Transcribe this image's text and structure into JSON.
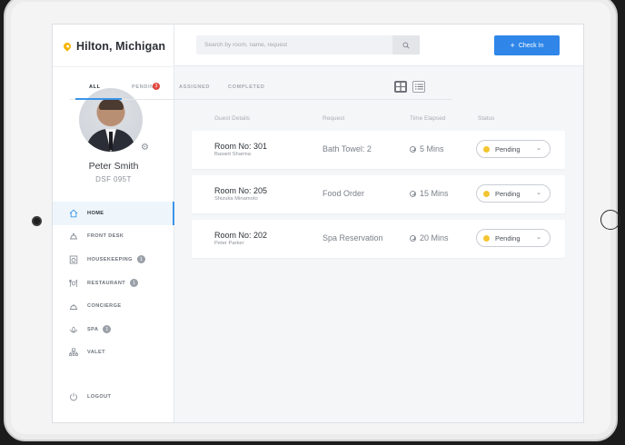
{
  "brand": {
    "title": "Hilton, Michigan",
    "icon": "location-pin-icon",
    "accent": "#f5b400"
  },
  "profile": {
    "name": "Peter Smith",
    "code": "DSF 095T"
  },
  "search": {
    "placeholder": "Search by room, name, request"
  },
  "actions": {
    "check_in_label": "Check In",
    "primary_color": "#2f86e8"
  },
  "nav": [
    {
      "label": "HOME",
      "icon": "home-icon",
      "active": true,
      "badge": ""
    },
    {
      "label": "FRONT DESK",
      "icon": "bell-icon",
      "active": false,
      "badge": ""
    },
    {
      "label": "HOUSEKEEPING",
      "icon": "washer-icon",
      "active": false,
      "badge": "1"
    },
    {
      "label": "RESTAURANT",
      "icon": "cutlery-icon",
      "active": false,
      "badge": "1"
    },
    {
      "label": "CONCIERGE",
      "icon": "concierge-icon",
      "active": false,
      "badge": ""
    },
    {
      "label": "SPA",
      "icon": "spa-icon",
      "active": false,
      "badge": "1"
    },
    {
      "label": "VALET",
      "icon": "valet-icon",
      "active": false,
      "badge": ""
    }
  ],
  "logout": {
    "label": "LOGOUT"
  },
  "tabs": [
    {
      "label": "ALL",
      "active": true
    },
    {
      "label": "PENDING",
      "badge": "3"
    },
    {
      "label": "ASSIGNED"
    },
    {
      "label": "COMPLETED"
    }
  ],
  "columns": {
    "guest": "Guest Details",
    "request": "Request",
    "time": "Time Elapsed",
    "status": "Status"
  },
  "requests": [
    {
      "room": "Room No: 301",
      "guest": "Basant Sharma",
      "request": "Bath Towel: 2",
      "time": "5 Mins",
      "status": "Pending"
    },
    {
      "room": "Room No: 205",
      "guest": "Shizuka Minamoto",
      "request": "Food Order",
      "time": "15 Mins",
      "status": "Pending"
    },
    {
      "room": "Room No: 202",
      "guest": "Peter Parker",
      "request": "Spa Reservation",
      "time": "20 Mins",
      "status": "Pending"
    }
  ],
  "status_colors": {
    "pending": "#f3c531",
    "tab_badge": "#e0463f",
    "active_tab": "#3b95e8"
  }
}
